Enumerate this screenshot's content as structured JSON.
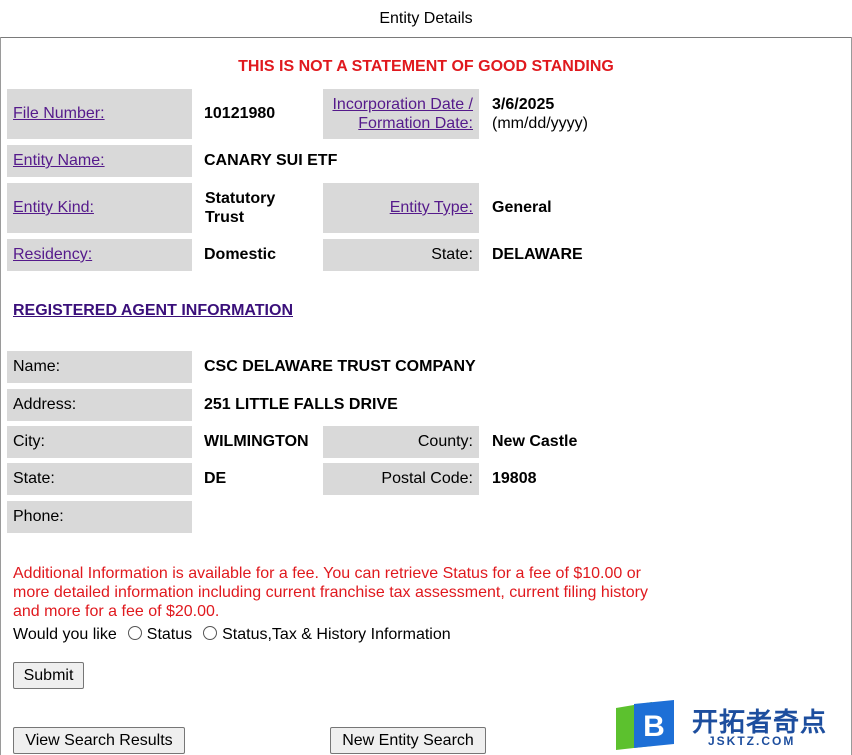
{
  "header": {
    "title": "Entity Details"
  },
  "warning": "THIS IS NOT A STATEMENT OF GOOD STANDING",
  "entity": {
    "file_number_label": "File Number:",
    "file_number": "10121980",
    "inc_date_label_1": "Incorporation Date /",
    "inc_date_label_2": "Formation Date:",
    "inc_date": "3/6/2025",
    "inc_date_format": "(mm/dd/yyyy)",
    "name_label": "Entity Name:",
    "name": "CANARY SUI ETF",
    "kind_label": "Entity Kind:",
    "kind_1": "Statutory",
    "kind_2": "Trust",
    "type_label": "Entity Type:",
    "type": "General",
    "residency_label": "Residency:",
    "residency": "Domestic",
    "state_label": "State:",
    "state": "DELAWARE"
  },
  "agent": {
    "section_title": "REGISTERED AGENT INFORMATION",
    "name_label": "Name:",
    "name": "CSC DELAWARE TRUST COMPANY",
    "address_label": "Address:",
    "address": "251 LITTLE FALLS DRIVE",
    "city_label": "City:",
    "city": "WILMINGTON",
    "county_label": "County:",
    "county": "New Castle",
    "state_label": "State:",
    "state": "DE",
    "postal_label": "Postal Code:",
    "postal": "19808",
    "phone_label": "Phone:",
    "phone": ""
  },
  "fee": {
    "text": "Additional Information is available for a fee. You can retrieve Status for a fee of $10.00 or more detailed information including current franchise tax assessment, current filing history and more for a fee of $20.00.",
    "question": "Would you like",
    "option_status": "Status",
    "option_full": "Status,Tax & History Information"
  },
  "buttons": {
    "submit": "Submit",
    "view_results": "View Search Results",
    "new_search": "New Entity Search"
  },
  "logo": {
    "cn": "开拓者奇点",
    "en": "JSKTZ.COM",
    "letter": "B"
  },
  "colors": {
    "warning": "#e0191e",
    "link": "#551a8b",
    "label_bg": "#d9d9d9",
    "logo_blue": "#1d4e9e",
    "logo_green": "#5cc12e"
  }
}
